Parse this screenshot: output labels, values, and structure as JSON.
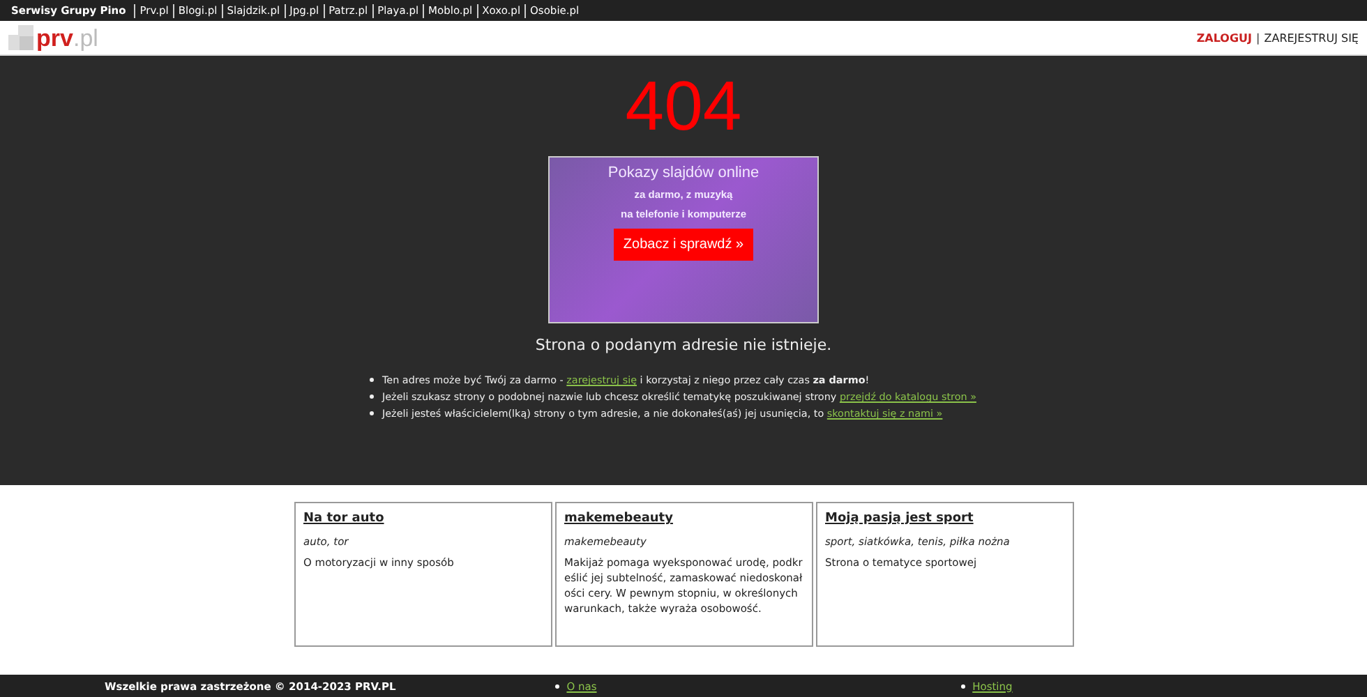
{
  "network_bar": {
    "title": "Serwisy Grupy Pino",
    "links": [
      "Prv.pl",
      "Blogi.pl",
      "Slajdzik.pl",
      "Jpg.pl",
      "Patrz.pl",
      "Playa.pl",
      "Moblo.pl",
      "Xoxo.pl",
      "Osobie.pl"
    ]
  },
  "header": {
    "logo_main": "prv",
    "logo_suffix": ".pl",
    "login": "ZALOGUJ",
    "separator": "|",
    "register": "ZAREJESTRUJ SIĘ"
  },
  "error_code": "404",
  "ad": {
    "title": "Pokazy slajdów online",
    "line_1": "za darmo, z muzyką",
    "line_2": "na telefonie i komputerze",
    "button": "Zobacz i sprawdź »"
  },
  "message": "Strona o podanym adresie nie istnieje.",
  "hints": [
    {
      "before": "Ten adres może być Twój za darmo - ",
      "link": "zarejestruj się",
      "after": " i korzystaj z niego przez cały czas **za darmo**!"
    },
    {
      "before": "Jeżeli szukasz strony o podobnej nazwie lub chcesz określić tematykę poszukiwanej strony ",
      "link": "przejdź do katalogu stron »"
    },
    {
      "before": "Jeżeli jesteś właścicielem(lką) strony o tym adresie, a nie dokonałeś(aś) jej usunięcia, to ",
      "link": "skontaktuj się z nami »"
    }
  ],
  "sites": [
    {
      "title": "Na tor auto",
      "tags": "auto, tor",
      "description": "O motoryzacji w inny sposób"
    },
    {
      "title": "makemebeauty",
      "tags": "makemebeauty",
      "description": "Makijaż pomaga wyeksponować urodę, podkreślić jej subtelność, zamaskować niedoskonałości cery. W pewnym stopniu, w określonych warunkach, także wyraża osobowość."
    },
    {
      "title": "Moją pasją jest sport",
      "tags": "sport, siatkówka, tenis, piłka nożna",
      "description": "Strona o tematyce sportowej"
    }
  ],
  "footer": {
    "copyright": "Wszelkie prawa zastrzeżone © 2014-2023 PRV.PL",
    "links": [
      "O nas",
      "Hosting"
    ]
  }
}
